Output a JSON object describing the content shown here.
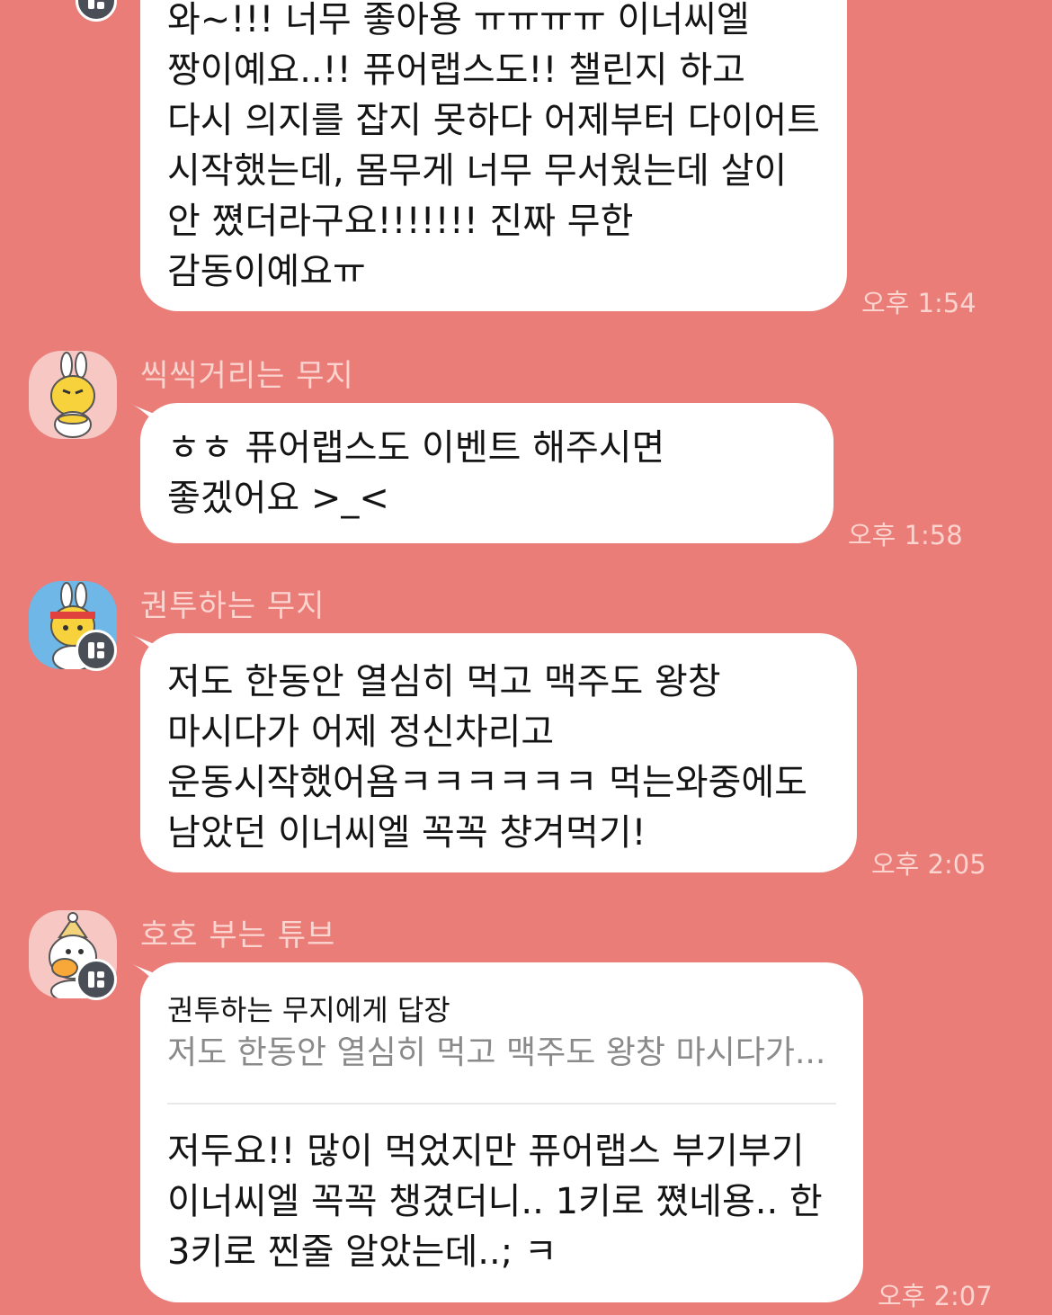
{
  "messages": [
    {
      "sender": "",
      "text": "와~!!! 너무 좋아용 ㅠㅠㅠㅠ 이너씨엘 짱이예요..!! 퓨어랩스도!! 챌린지 하고 다시 의지를 잡지 못하다 어제부터 다이어트 시작했는데, 몸무게 너무 무서웠는데 살이 안 쪘더라구요!!!!!!! 진짜 무한 감동이예요ㅠ",
      "time": "오후 1:54"
    },
    {
      "sender": "씩씩거리는 무지",
      "text": "ㅎㅎ 퓨어랩스도 이벤트 해주시면 좋겠어요 >_<",
      "time": "오후 1:58"
    },
    {
      "sender": "권투하는 무지",
      "text": "저도 한동안 열심히 먹고 맥주도 왕창 마시다가 어제 정신차리고 운동시작했어욤ㅋㅋㅋㅋㅋㅋ 먹는와중에도 남았던 이너씨엘 꼭꼭 챵겨먹기!",
      "time": "오후 2:05"
    },
    {
      "sender": "호호 부는 튜브",
      "reply_to": "권투하는 무지에게 답장",
      "reply_preview": "저도 한동안 열심히 먹고 맥주도 왕창 마시다가...",
      "text": "저두요!! 많이 먹었지만 퓨어랩스 부기부기 이너씨엘 꼭꼭 챙겼더니.. 1키로 쪘네용.. 한 3키로 찐줄 알았는데..; ㅋ",
      "time": "오후 2:07"
    }
  ],
  "colors": {
    "background": "#ea7d77",
    "bubble": "#ffffff",
    "meta_text": "#fbd3cf",
    "badge": "#4a4f57"
  },
  "icons": [
    "muzi-angry-avatar",
    "muzi-boxing-avatar",
    "tube-blowing-avatar",
    "chat-badge-icon"
  ]
}
